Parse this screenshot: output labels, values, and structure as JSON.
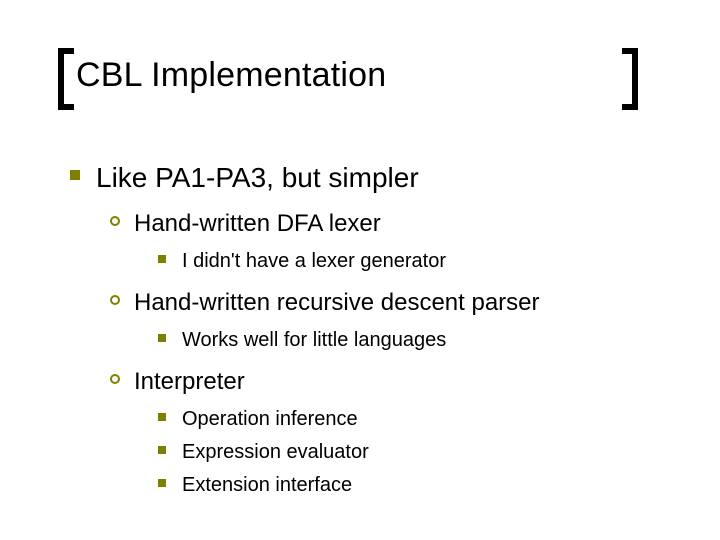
{
  "title": "CBL Implementation",
  "bullets": {
    "lvl1": "Like PA1-PA3, but simpler",
    "lvl2_a": "Hand-written DFA lexer",
    "lvl3_a1": "I didn't have a lexer generator",
    "lvl2_b": "Hand-written recursive descent parser",
    "lvl3_b1": "Works well for little languages",
    "lvl2_c": "Interpreter",
    "lvl3_c1": "Operation inference",
    "lvl3_c2": "Expression evaluator",
    "lvl3_c3": "Extension interface"
  },
  "colors": {
    "accent": "#808000"
  }
}
